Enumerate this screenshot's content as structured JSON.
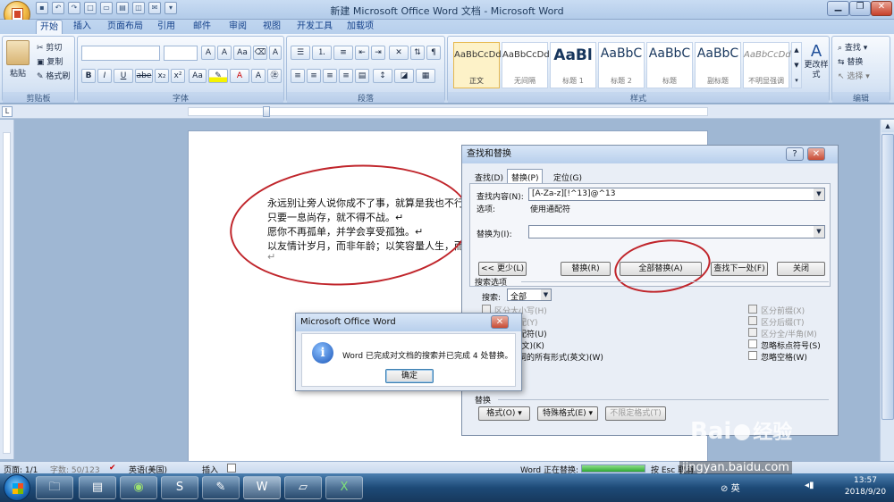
{
  "window": {
    "title": "新建 Microsoft Office Word 文档 - Microsoft Word"
  },
  "tabs": [
    "开始",
    "插入",
    "页面布局",
    "引用",
    "邮件",
    "审阅",
    "视图",
    "开发工具",
    "加载项"
  ],
  "ribbon": {
    "clipboard": {
      "paste": "粘贴",
      "cut": "剪切",
      "copy": "复制",
      "format_painter": "格式刷",
      "label": "剪贴板"
    },
    "font": {
      "label": "字体",
      "bold": "B",
      "italic": "I",
      "underline": "U",
      "strike": "abe",
      "sub": "x₂",
      "sup": "x²",
      "aa": "Aa",
      "grow": "A",
      "shrink": "A"
    },
    "paragraph": {
      "label": "段落"
    },
    "styles": {
      "label": "样式",
      "items": [
        {
          "preview": "AaBbCcDd",
          "name": "正文"
        },
        {
          "preview": "AaBbCcDd",
          "name": "无间隔"
        },
        {
          "preview": "AaBl",
          "name": "标题 1"
        },
        {
          "preview": "AaBbC",
          "name": "标题 2"
        },
        {
          "preview": "AaBbC",
          "name": "标题"
        },
        {
          "preview": "AaBbC",
          "name": "副标题"
        },
        {
          "preview": "AaBbCcDd",
          "name": "不明显强调"
        }
      ],
      "change": "更改样式"
    },
    "editing": {
      "label": "编辑",
      "find": "查找",
      "replace": "替换",
      "select": "选择"
    }
  },
  "document": {
    "lines": [
      "永远别让旁人说你成不了事，就算是我也不行。",
      "只要一息尚存，就不得不战。↵",
      "愿你不再孤单，并学会享受孤独。↵",
      "以友情计岁月，而非年龄；以笑容量人生，而非",
      "↵"
    ]
  },
  "find_replace": {
    "title": "查找和替换",
    "tabs": [
      "查找(D)",
      "替换(P)",
      "定位(G)"
    ],
    "find_label": "查找内容(N):",
    "find_value": "[A-Za-z][!^13]@^13",
    "options_label": "选项:",
    "options_value": "使用通配符",
    "replace_label": "替换为(I):",
    "replace_value": "",
    "buttons": {
      "less": "<< 更少(L)",
      "replace": "替换(R)",
      "replace_all": "全部替换(A)",
      "find_next": "查找下一处(F)",
      "close": "关闭"
    },
    "search_options": "搜索选项",
    "search_label": "搜索:",
    "search_value": "全部",
    "left_checks": [
      "区分大小写(H)",
      "全字匹配(Y)",
      "使用通配符(U)",
      "同音(英文)(K)",
      "查找单词的所有形式(英文)(W)"
    ],
    "right_checks": [
      "区分前缀(X)",
      "区分后缀(T)",
      "区分全/半角(M)",
      "忽略标点符号(S)",
      "忽略空格(W)"
    ],
    "replace_section": "替换",
    "bottom_buttons": [
      "格式(O) ▾",
      "特殊格式(E) ▾",
      "不限定格式(T)"
    ],
    "help": "?",
    "close_x": "✕"
  },
  "message": {
    "title": "Microsoft Office Word",
    "text": "Word 已完成对文档的搜索并已完成 4 处替换。",
    "ok": "确定",
    "close_x": "✕"
  },
  "status": {
    "page": "页面: 1/1",
    "words": "字数: 50/123",
    "lang": "英语(美国)",
    "insert": "插入",
    "replacing": "Word 正在替换:",
    "cancel": "按 Esc 取消"
  },
  "watermark": {
    "brand": "Bai",
    "brand2": "经验",
    "url": "jingyan.baidu.com"
  },
  "taskbar": {
    "tray_lang": "英",
    "time": "13:57",
    "date": "2018/9/20"
  }
}
